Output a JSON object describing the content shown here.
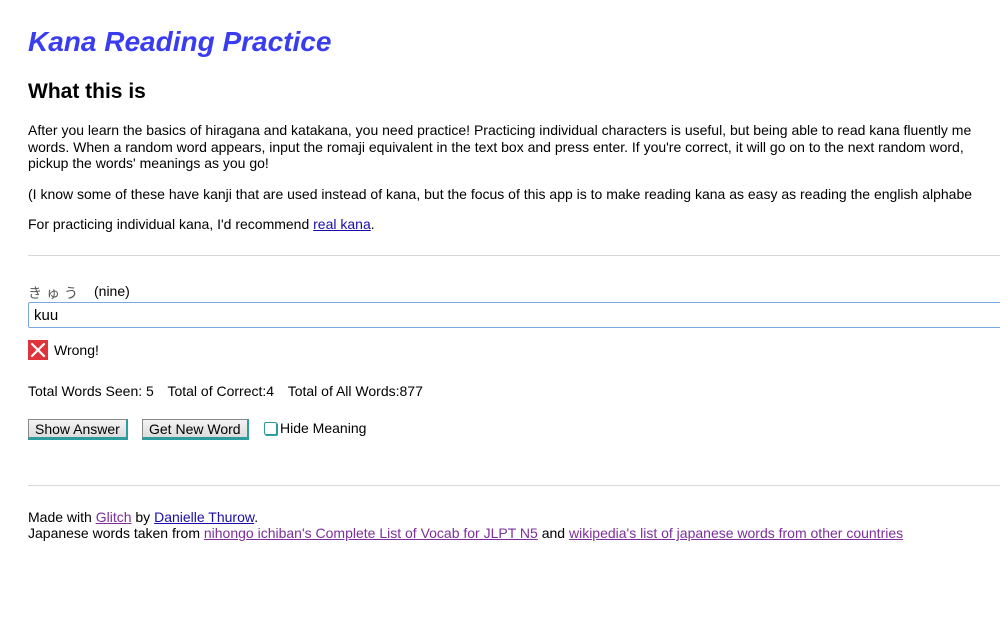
{
  "header": {
    "title": "Kana Reading Practice"
  },
  "about": {
    "heading": "What this is",
    "para1_line1": "After you learn the basics of hiragana and katakana, you need practice! Practicing individual characters is useful, but being able to read kana fluently me",
    "para1_line2": "words. When a random word appears, input the romaji equivalent in the text box and press enter. If you're correct, it will go on to the next random word,",
    "para1_line3": "pickup the words' meanings as you go!",
    "para2": "(I know some of these have kanji that are used instead of kana, but the focus of this app is to make reading kana as easy as reading the english alphabe",
    "para3_prefix": "For practicing individual kana, I'd recommend ",
    "para3_link": "real kana",
    "para3_suffix": "."
  },
  "practice": {
    "word_kana": "きゅう",
    "word_meaning": "(nine)",
    "answer_value": "kuu",
    "result_text": "Wrong!",
    "result_color": "#e0343b",
    "stats": {
      "seen": "Total Words Seen: 5",
      "correct": "Total of Correct:4",
      "all": "Total of All Words:877"
    },
    "show_answer_label": "Show Answer",
    "new_word_label": "Get New Word",
    "hide_meaning_label": "Hide Meaning"
  },
  "footer": {
    "made_with": "Made with ",
    "glitch": "Glitch",
    "by": " by ",
    "author": "Danielle Thurow",
    "period": ".",
    "taken_from": "Japanese words taken from ",
    "source1": "nihongo ichiban's Complete List of Vocab for JLPT N5",
    "and": " and ",
    "source2": "wikipedia's list of japanese words from other countries"
  },
  "colors": {
    "title": "#3a3cf0",
    "link": "#1a0dab",
    "visited": "#7b2f9b",
    "accent": "#2c9c9c"
  },
  "icons": {
    "result": "x-mark-icon"
  }
}
